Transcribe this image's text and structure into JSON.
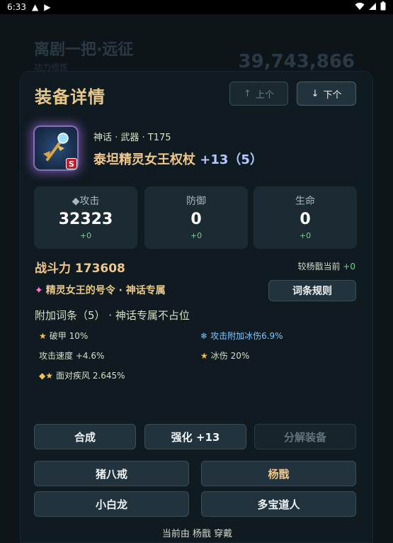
{
  "status_bar": {
    "time": "6:33"
  },
  "background": {
    "title": "离剧一把·远征",
    "subtitle": "功力修炼",
    "score": "39,743,866"
  },
  "modal": {
    "title": "装备详情",
    "prev_label": "上个",
    "next_label": "下个"
  },
  "item": {
    "meta": "神话 · 武器 · T175",
    "name": "泰坦精灵女王权杖",
    "enhance": "+13（5）",
    "badge": "S"
  },
  "stats": [
    {
      "label": "◆攻击",
      "value": "32323",
      "bonus": "+0"
    },
    {
      "label": "防御",
      "value": "0",
      "bonus": "+0"
    },
    {
      "label": "生命",
      "value": "0",
      "bonus": "+0"
    }
  ],
  "power": {
    "label": "战斗力 173608",
    "compare_label": "较杨戬当前",
    "compare_value": "+0"
  },
  "skill": {
    "icon": "✦",
    "text": "精灵女王的号令 · 神话专属",
    "rule_button": "词条规则"
  },
  "affix": {
    "header": "附加词条（5） · 神话专属不占位",
    "items": [
      {
        "text": "破甲 10%",
        "icon": "★"
      },
      {
        "text": "攻击附加冰伤6.9%",
        "icon": "❄"
      },
      {
        "text": "攻击速度 +4.6%",
        "icon": ""
      },
      {
        "text": "冰伤 20%",
        "icon": "★"
      },
      {
        "text": "面对疾风 2.645%",
        "icon": "◆★"
      }
    ]
  },
  "actions": {
    "merge": "合成",
    "enhance": "强化 +13",
    "dismantle": "分解装备"
  },
  "characters": [
    "猪八戒",
    "杨戬",
    "小白龙",
    "多宝道人"
  ],
  "footer": "当前由 杨戬 穿戴",
  "colors": {
    "gold": "#f0c78b",
    "green": "#6fd58a",
    "ice": "#7cc8ff",
    "panel": "#1b2a33"
  }
}
